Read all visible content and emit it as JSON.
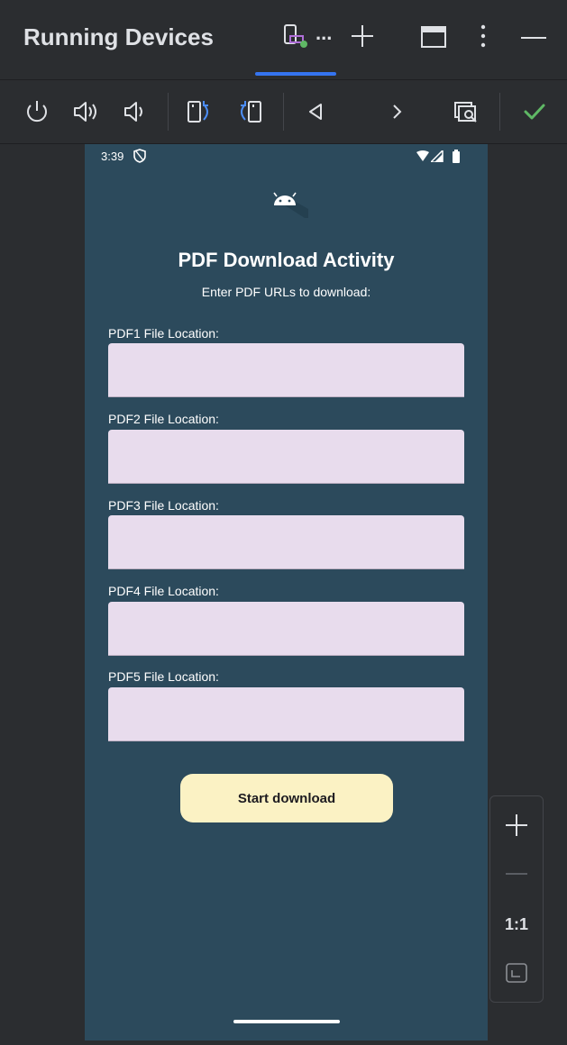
{
  "window": {
    "title": "Running Devices",
    "tab_overflow": "..."
  },
  "toolbar": {
    "icons": [
      "power-icon",
      "volume-up-icon",
      "volume-down-icon",
      "rotate-right-icon",
      "rotate-left-icon",
      "back-icon",
      "overview-icon",
      "screenshot-icon",
      "check-icon"
    ]
  },
  "device": {
    "status_time": "3:39",
    "title": "PDF Download Activity",
    "subtitle": "Enter PDF URLs to download:",
    "fields": [
      {
        "label": "PDF1 File Location:",
        "value": ""
      },
      {
        "label": "PDF2 File Location:",
        "value": ""
      },
      {
        "label": "PDF3 File Location:",
        "value": ""
      },
      {
        "label": "PDF4 File Location:",
        "value": ""
      },
      {
        "label": "PDF5 File Location:",
        "value": ""
      }
    ],
    "button_label": "Start download"
  },
  "zoom": {
    "reset_label": "1:1"
  },
  "colors": {
    "accent": "#3574f0",
    "screen_bg": "#2c4a5c",
    "input_bg": "#e8dced",
    "button_bg": "#fbf2c4",
    "check": "#5fb865"
  }
}
